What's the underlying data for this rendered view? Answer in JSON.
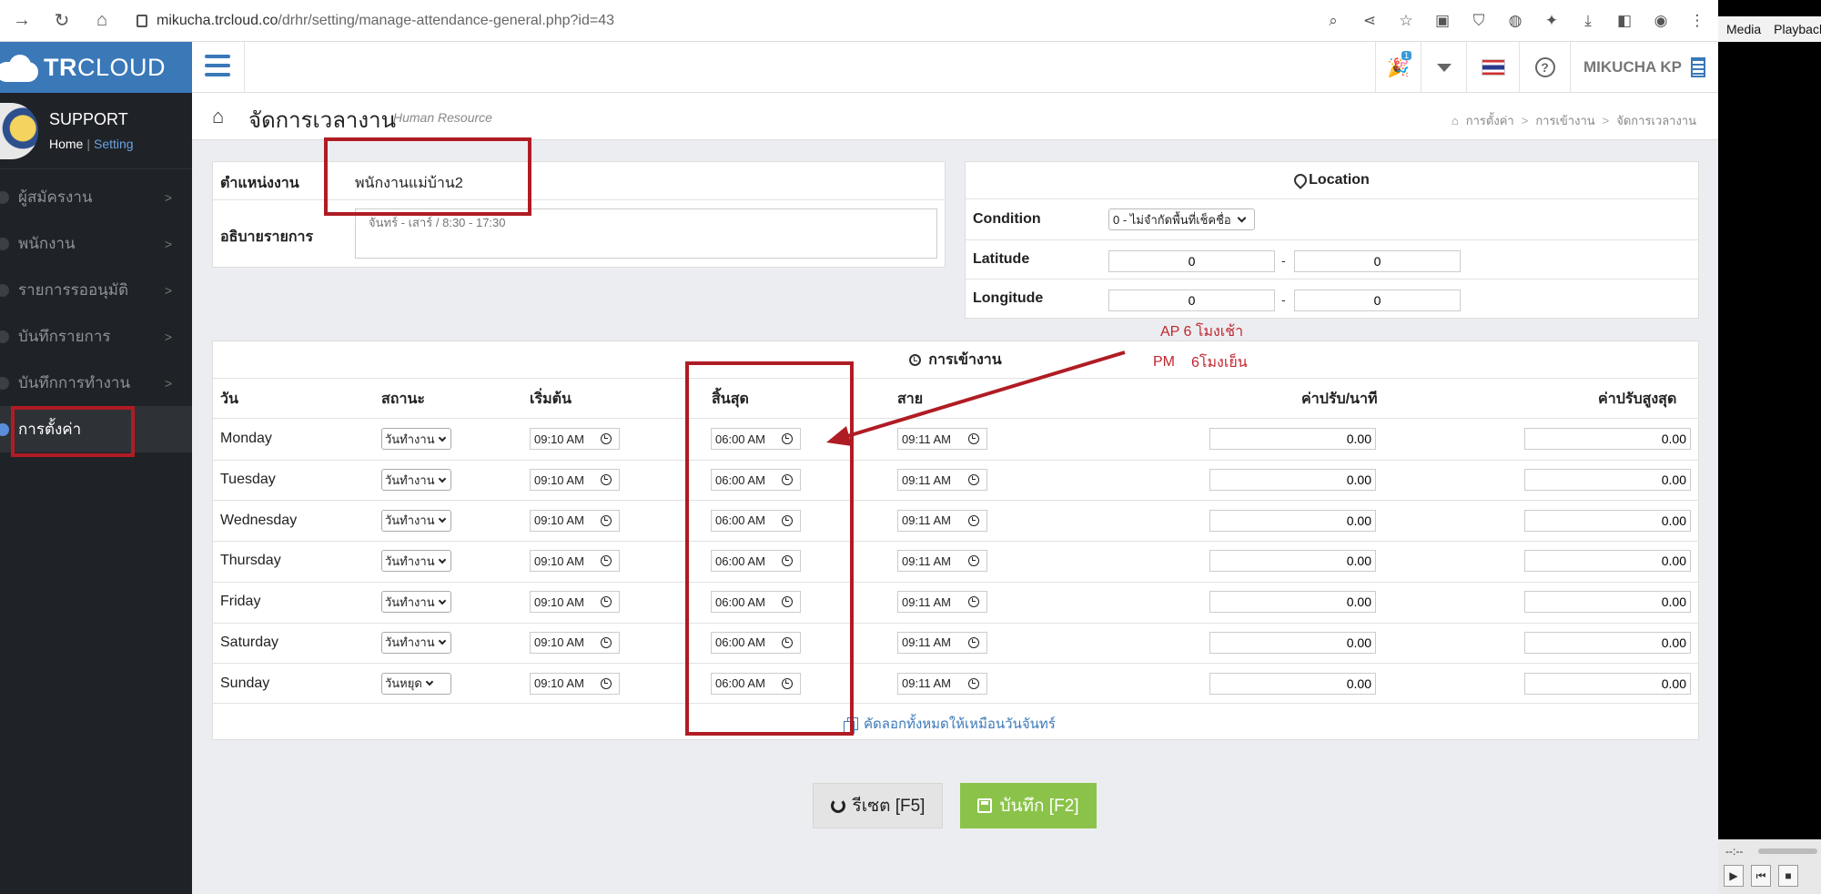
{
  "browser": {
    "url_host": "mikucha.trcloud.co",
    "url_path": "/drhr/setting/manage-attendance-general.php?id=43"
  },
  "media": {
    "menu": [
      "Media",
      "Playback"
    ],
    "time": "--:--"
  },
  "sidebar": {
    "brand_bold": "TR",
    "brand_thin": "CLOUD",
    "profile_title": "SUPPORT",
    "link_home": "Home",
    "link_sep": "|",
    "link_setting": "Setting",
    "items": [
      {
        "label": "ผู้สมัครงาน",
        "active": false
      },
      {
        "label": "พนักงาน",
        "active": false
      },
      {
        "label": "รายการรออนุมัติ",
        "active": false
      },
      {
        "label": "บันทึกรายการ",
        "active": false
      },
      {
        "label": "บันทึกการทำงาน",
        "active": false
      },
      {
        "label": "การตั้งค่า",
        "active": true
      }
    ]
  },
  "topbar": {
    "badge": "1",
    "user": "MIKUCHA KP"
  },
  "page": {
    "title": "จัดการเวลางาน",
    "subtitle": "Human Resource",
    "breadcrumb": [
      "การตั้งค่า",
      "การเข้างาน",
      "จัดการเวลางาน"
    ]
  },
  "position": {
    "label": "ตำแหน่งงาน",
    "value": "พนักงานแม่บ้าน2",
    "desc_label": "อธิบายรายการ",
    "desc_placeholder": "จันทร์ - เสาร์ / 8:30 - 17:30"
  },
  "location": {
    "title": "Location",
    "condition_label": "Condition",
    "condition_value": "0 - ไม่จำกัดพื้นที่เช็คชื่อ",
    "latitude_label": "Latitude",
    "lat_from": "0",
    "lat_to": "0",
    "longitude_label": "Longitude",
    "lng_from": "0",
    "lng_to": "0",
    "dash": "-"
  },
  "attendance": {
    "title": "การเข้างาน",
    "headers": {
      "day": "วัน",
      "status": "สถานะ",
      "start": "เริ่มต้น",
      "end": "สิ้นสุด",
      "late": "สาย",
      "fine_per_min": "ค่าปรับ/นาที",
      "fine_max": "ค่าปรับสูงสุด"
    },
    "rows": [
      {
        "day": "Monday",
        "status": "วันทำงาน",
        "start": "09:10 AM",
        "end": "06:00 AM",
        "late": "09:11 AM",
        "fine": "0.00",
        "max": "0.00"
      },
      {
        "day": "Tuesday",
        "status": "วันทำงาน",
        "start": "09:10 AM",
        "end": "06:00 AM",
        "late": "09:11 AM",
        "fine": "0.00",
        "max": "0.00"
      },
      {
        "day": "Wednesday",
        "status": "วันทำงาน",
        "start": "09:10 AM",
        "end": "06:00 AM",
        "late": "09:11 AM",
        "fine": "0.00",
        "max": "0.00"
      },
      {
        "day": "Thursday",
        "status": "วันทำงาน",
        "start": "09:10 AM",
        "end": "06:00 AM",
        "late": "09:11 AM",
        "fine": "0.00",
        "max": "0.00"
      },
      {
        "day": "Friday",
        "status": "วันทำงาน",
        "start": "09:10 AM",
        "end": "06:00 AM",
        "late": "09:11 AM",
        "fine": "0.00",
        "max": "0.00"
      },
      {
        "day": "Saturday",
        "status": "วันทำงาน",
        "start": "09:10 AM",
        "end": "06:00 AM",
        "late": "09:11 AM",
        "fine": "0.00",
        "max": "0.00"
      },
      {
        "day": "Sunday",
        "status": "วันหยุด",
        "start": "09:10 AM",
        "end": "06:00 AM",
        "late": "09:11 AM",
        "fine": "0.00",
        "max": "0.00"
      }
    ],
    "copy_link": "คัดลอกทั้งหมดให้เหมือนวันจันทร์"
  },
  "buttons": {
    "reset": "รีเซต [F5]",
    "save": "บันทึก [F2]"
  },
  "annotations": {
    "am": "AP 6 โมงเช้า",
    "pm_label": "PM",
    "pm_text": "6โมงเย็น"
  },
  "colors": {
    "brand": "#3a78b8",
    "save": "#8bc34a",
    "annotation": "#b01c24"
  }
}
